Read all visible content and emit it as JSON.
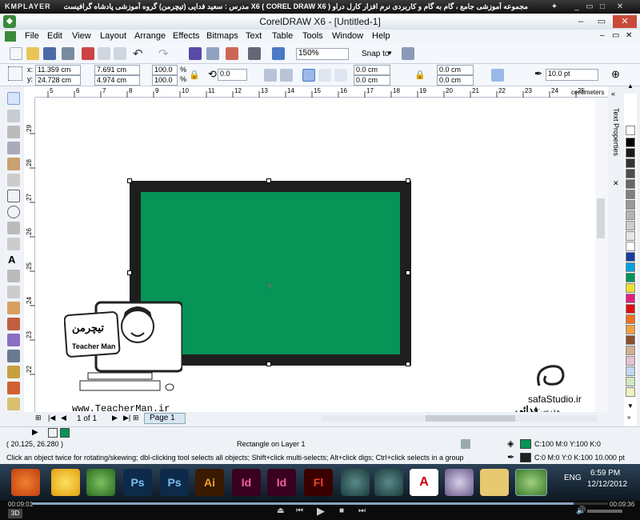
{
  "player": {
    "logo": "KMPLAYER",
    "title": "مجموعه آموزشی جامع ، گام به گام و کاربردی نرم افزار کارل دراو X6 ( COREL DRAW X6 )   مدرس : سعید فدایی (تیچرمن) گروه آموزشی پادشاه گرافیست ها",
    "time_current": "00:09:01",
    "time_total": "00:09:36",
    "progress": 0.94,
    "badge": "3D"
  },
  "window": {
    "title": "CorelDRAW X6 - [Untitled-1]"
  },
  "menu": [
    "File",
    "Edit",
    "View",
    "Layout",
    "Arrange",
    "Effects",
    "Bitmaps",
    "Text",
    "Table",
    "Tools",
    "Window",
    "Help"
  ],
  "toolbar": {
    "zoom": "150%",
    "snap_to": "Snap to"
  },
  "properties": {
    "x": "11.359 cm",
    "y": "24.728 cm",
    "w": "7.691 cm",
    "h": "4.974 cm",
    "scale_w": "100.0",
    "scale_h": "100.0",
    "pct": "%",
    "rotation": "0.0",
    "corner1": "0.0 cm",
    "corner2": "0.0 cm",
    "corner3": "0.0 cm",
    "corner4": "0.0 cm",
    "outline_width": "10.0 pt",
    "x_label": "x:",
    "y_label": "y:"
  },
  "ruler": {
    "unit": "centimeters",
    "h_ticks": [
      "5",
      "6",
      "7",
      "8",
      "9",
      "10",
      "11",
      "12",
      "13",
      "14",
      "15",
      "16",
      "17",
      "18",
      "19",
      "20",
      "21",
      "22",
      "23",
      "24",
      "25"
    ],
    "v_ticks": [
      "29",
      "28",
      "27",
      "26",
      "25",
      "24",
      "23",
      "22"
    ],
    "v_unit": "centimeters"
  },
  "docker": {
    "title": "Text Properties"
  },
  "page": {
    "count": "1 of 1",
    "tab": "Page 1"
  },
  "status": {
    "coords": "( 20.125, 26.280 )",
    "object": "Rectangle on Layer 1",
    "hint": "Click an object twice for rotating/skewing; dbl-clicking tool selects all objects; Shift+click multi-selects; Alt+click digs; Ctrl+click selects in a group",
    "fill": "C:100 M:0 Y:100 K:0",
    "outline": "C:0 M:0 Y:0 K:100  10.000 pt"
  },
  "colors": {
    "rect_fill": "#069457",
    "rect_outline": "#1e1e1e"
  },
  "watermark": {
    "brand_fa": "تیچرمن",
    "brand_en": "Teacher Man",
    "url": "www.TeacherMan.ir",
    "studio": "safaStudio.ir",
    "teacher_label": "مدرس: مهندس",
    "teacher_name": "فدائی"
  },
  "taskbar": {
    "lang": "ENG",
    "time": "6:59 PM",
    "date": "12/12/2012",
    "apps": [
      "firefox-icon",
      "kmplayer-star-icon",
      "coreldraw-icon",
      "photoshop-icon",
      "photoshop-icon",
      "illustrator-icon",
      "indesign-icon",
      "indesign-icon",
      "flash-icon",
      "3dsmax-icon",
      "3dsmax-icon",
      "acrobat-icon",
      "disc-icon",
      "folder-icon",
      "coreldraw-active-icon"
    ],
    "app_labels": [
      "",
      "",
      "",
      "Ps",
      "Ps",
      "Ai",
      "Id",
      "Id",
      "Fl",
      "",
      "",
      "",
      "",
      "",
      ""
    ]
  }
}
